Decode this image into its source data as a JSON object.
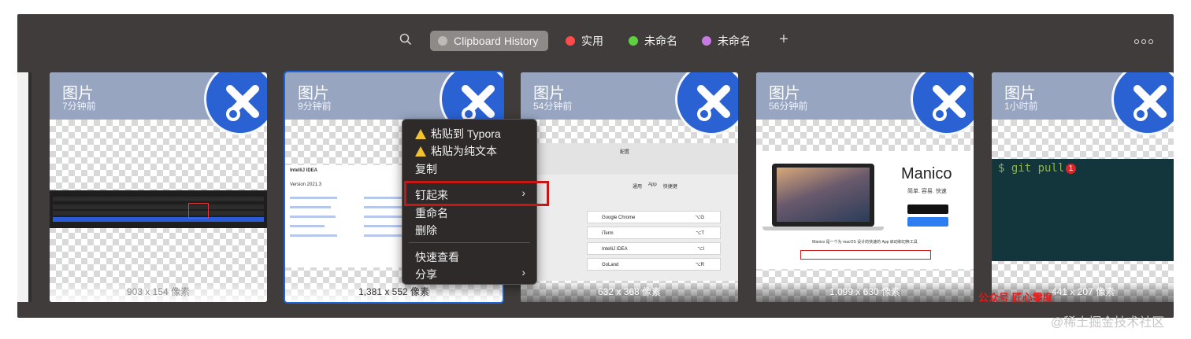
{
  "toolbar": {
    "tabs": [
      {
        "label": "Clipboard History",
        "color": "#bdbab8"
      },
      {
        "label": "实用",
        "color": "#ff4a4a"
      },
      {
        "label": "未命名",
        "color": "#5ed23e"
      },
      {
        "label": "未命名",
        "color": "#c77ae0"
      }
    ]
  },
  "cards": [
    {
      "title": "图片",
      "time": "7分钟前",
      "size": "903 x 154 像素"
    },
    {
      "title": "图片",
      "time": "9分钟前",
      "size": "1,381 x 552 像素"
    },
    {
      "title": "图片",
      "time": "54分钟前",
      "size": "632 x 368 像素"
    },
    {
      "title": "图片",
      "time": "56分钟前",
      "size": "1,099 x 630 像素"
    },
    {
      "title": "图片",
      "time": "1小时前",
      "size": "441 x 207 像素"
    }
  ],
  "thumbs": {
    "prefs_title": "配置",
    "prefs_tabs": [
      "通用",
      "App",
      "快捷键"
    ],
    "prefs_rows": [
      "Google Chrome",
      "iTerm",
      "IntelliJ IDEA",
      "GoLand"
    ],
    "prefs_keys": [
      "⌥G",
      "⌥T",
      "⌥I",
      "⌥R"
    ],
    "idea_title": "IntelliJ IDEA",
    "idea_version": "Version 2021.3",
    "manico_title": "Manico",
    "manico_sub": "简单. 容易. 快速",
    "manico_desc": "Manico 是一个为 macOS 设计的快速的 App 启动和切换工具",
    "terminal_text": "$ git pull"
  },
  "menu": {
    "items": [
      {
        "label": "粘贴到 Typora",
        "icon": "warning-icon"
      },
      {
        "label": "粘贴为纯文本",
        "icon": "warning-icon"
      },
      {
        "label": "复制"
      },
      {
        "label": "钉起来",
        "submenu": true
      },
      {
        "label": "重命名"
      },
      {
        "label": "删除"
      },
      {
        "label": "快速查看"
      },
      {
        "label": "分享",
        "submenu": true
      }
    ]
  },
  "annotations": {
    "red_text": "公众号 匠心零度",
    "badge": "1"
  },
  "watermark": "@稀土掘金技术社区"
}
